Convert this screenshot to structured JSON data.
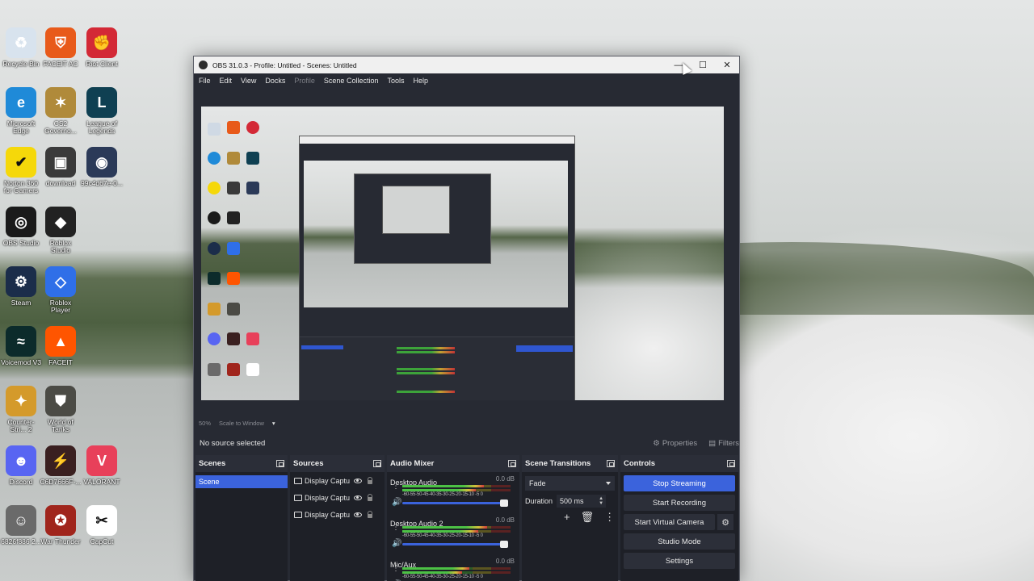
{
  "desktop": {
    "icons": [
      {
        "label": "Recycle Bin",
        "color": "#d8e3ee",
        "glyph": "♻"
      },
      {
        "label": "FACEIT AC",
        "color": "#e85a1a",
        "glyph": "⛨"
      },
      {
        "label": "Riot Client",
        "color": "#d32936",
        "glyph": "✊"
      },
      {
        "label": "Microsoft Edge",
        "color": "#1f8ad8",
        "glyph": "e"
      },
      {
        "label": "CS2 Governo...",
        "color": "#b08a3a",
        "glyph": "✶"
      },
      {
        "label": "League of Legends",
        "color": "#0f4052",
        "glyph": "L"
      },
      {
        "label": "Norton 360 for Gamers",
        "color": "#f5d80a",
        "glyph": "✔"
      },
      {
        "label": "download",
        "color": "#3a3a3a",
        "glyph": "▣"
      },
      {
        "label": "99c4d67e-0...",
        "color": "#2b3a58",
        "glyph": "◉"
      },
      {
        "label": "OBS Studio",
        "color": "#1a1a1a",
        "glyph": "◎"
      },
      {
        "label": "Roblox Studio",
        "color": "#222222",
        "glyph": "◆"
      },
      {
        "label": "Steam",
        "color": "#1b2d4a",
        "glyph": "⚙"
      },
      {
        "label": "Roblox Player",
        "color": "#2f6fe8",
        "glyph": "◇"
      },
      {
        "label": "Voicemod V3",
        "color": "#0c2b2b",
        "glyph": "≈"
      },
      {
        "label": "FACEIT",
        "color": "#ff5500",
        "glyph": "▲"
      },
      {
        "label": "Counter-Stri... 2",
        "color": "#d49a2b",
        "glyph": "✦"
      },
      {
        "label": "World of Tanks",
        "color": "#4b4b45",
        "glyph": "⛊"
      },
      {
        "label": "Discord",
        "color": "#5865f2",
        "glyph": "☻"
      },
      {
        "label": "C6D7666F-...",
        "color": "#3a2020",
        "glyph": "⚡"
      },
      {
        "label": "VALORANT",
        "color": "#e8405a",
        "glyph": "V"
      },
      {
        "label": "6826f886 2...",
        "color": "#6a6a6a",
        "glyph": "☺"
      },
      {
        "label": "War Thunder",
        "color": "#a0251c",
        "glyph": "✪"
      },
      {
        "label": "CapCut",
        "color": "#ffffff",
        "glyph": "✂"
      }
    ]
  },
  "window": {
    "title": "OBS 31.0.3 - Profile: Untitled - Scenes: Untitled",
    "minimize": "—",
    "maximize": "☐",
    "close": "✕"
  },
  "menu": [
    "File",
    "Edit",
    "View",
    "Docks",
    "Profile",
    "Scene Collection",
    "Tools",
    "Help"
  ],
  "status": {
    "zoom": "50%",
    "scale_mode": "Scale to Window"
  },
  "context": {
    "no_source": "No source selected",
    "properties": "Properties",
    "filters": "Filters"
  },
  "scenes": {
    "title": "Scenes",
    "items": [
      "Scene"
    ]
  },
  "sources": {
    "title": "Sources",
    "items": [
      "Display Captu",
      "Display Captu",
      "Display Captu"
    ]
  },
  "mixer": {
    "title": "Audio Mixer",
    "scale": "-60-55-50-45-40-35-30-25-20-15-10 -5  0",
    "channels": [
      {
        "name": "Desktop Audio",
        "db": "0.0 dB",
        "level": 0.75,
        "level2": 0.68
      },
      {
        "name": "Desktop Audio 2",
        "db": "0.0 dB",
        "level": 0.78,
        "level2": 0.7
      },
      {
        "name": "Mic/Aux",
        "db": "0.0 dB",
        "level": 0.62,
        "level2": 0.55
      }
    ]
  },
  "transitions": {
    "title": "Scene Transitions",
    "selected": "Fade",
    "duration_label": "Duration",
    "duration_value": "500 ms"
  },
  "controls": {
    "title": "Controls",
    "stop_streaming": "Stop Streaming",
    "start_recording": "Start Recording",
    "start_virtual_camera": "Start Virtual Camera",
    "studio_mode": "Studio Mode",
    "settings": "Settings"
  },
  "colors": {
    "accent": "#3b63dc",
    "panel": "#1e2027",
    "window_bg": "#272a33"
  }
}
